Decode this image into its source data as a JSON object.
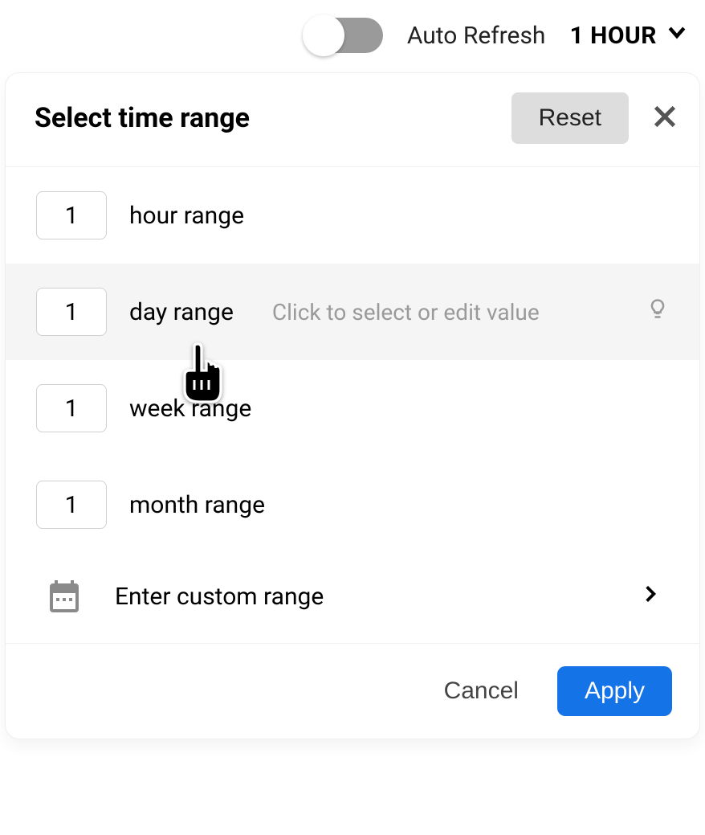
{
  "topbar": {
    "auto_refresh_label": "Auto Refresh",
    "current_range_label": "1 HOUR"
  },
  "popover": {
    "title": "Select time range",
    "reset_label": "Reset",
    "rows": [
      {
        "value": "1",
        "label": "hour range"
      },
      {
        "value": "1",
        "label": "day range",
        "hint": "Click to select or edit value"
      },
      {
        "value": "1",
        "label": "week range"
      },
      {
        "value": "1",
        "label": "month range"
      }
    ],
    "custom_row_label": "Enter custom range",
    "footer": {
      "cancel_label": "Cancel",
      "apply_label": "Apply"
    }
  }
}
